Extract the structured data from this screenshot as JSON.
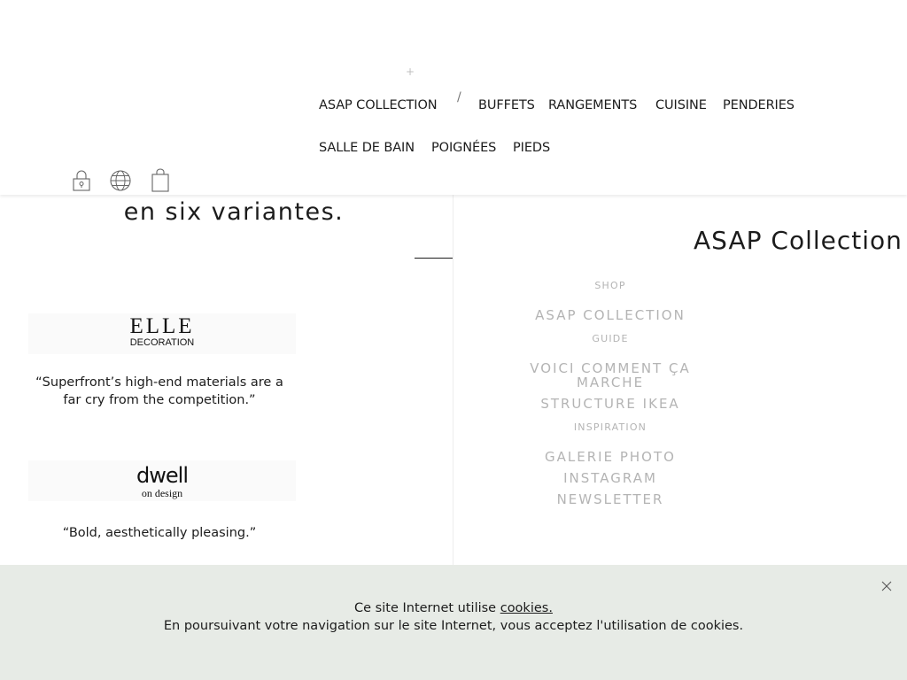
{
  "header": {
    "plus_mark": "+",
    "nav_sep": "/",
    "nav": {
      "asap": "ASAP COLLECTION",
      "buffets": "BUFFETS",
      "rangements": "RANGEMENTS",
      "cuisine": "CUISINE",
      "penderies": "PENDERIES",
      "salle_de_bain": "SALLE DE BAIN",
      "poignees": "POIGNÉES",
      "pieds": "PIEDS"
    },
    "icons": [
      "lock-icon",
      "globe-icon",
      "shopping-bag-icon"
    ]
  },
  "left": {
    "tagline": "en six variantes.",
    "press": [
      {
        "logo_line1": "ELLE",
        "logo_line2": "DECORATION",
        "quote": "“Superfront’s high-end materials are a far cry from the competition.”"
      },
      {
        "logo_line1": "dwell",
        "logo_line2": "on design",
        "quote": "“Bold, aesthetically pleasing.”"
      }
    ]
  },
  "panel": {
    "title": "ASAP Collection",
    "shop_head": "SHOP",
    "shop_link": "ASAP COLLECTION",
    "guide_head": "GUIDE",
    "guide_link1_line1": "VOICI COMMENT ÇA",
    "guide_link1_line2": "MARCHE",
    "guide_link2": "STRUCTURE IKEA",
    "inspiration_head": "INSPIRATION",
    "inspiration_links": [
      "GALERIE PHOTO",
      "INSTAGRAM",
      "NEWSLETTER"
    ]
  },
  "cookie": {
    "line1_prefix": "Ce site Internet utilise ",
    "line1_link": "cookies.",
    "line2": "En poursuivant votre navigation sur le site Internet, vous acceptez l'utilisation de cookies."
  },
  "colors": {
    "cookie_bg": "#e7ebe6",
    "muted": "#b4b4b4",
    "text": "#1c1c1c"
  }
}
